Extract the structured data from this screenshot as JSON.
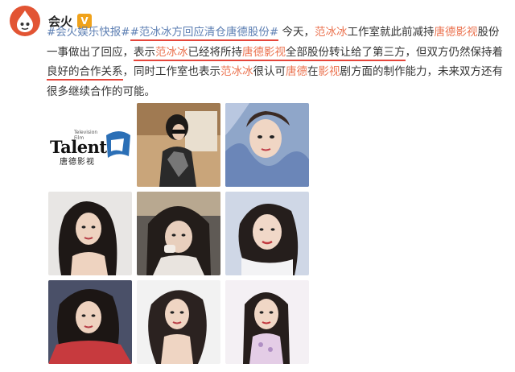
{
  "user": {
    "name": "会火",
    "verified_badge": "V",
    "avatar_icon": "flame-drop-icon"
  },
  "post": {
    "hashtag1": "#会火娱乐快报#",
    "hashtag2": "#范冰冰方回应清仓唐德股份#",
    "t1": " 今天，",
    "k1": "范冰冰",
    "t2": "工作室就此前减持",
    "k2": "唐德影视",
    "t3": "股份一事做出了回应，",
    "t4": "表示",
    "k3": "范冰冰",
    "t5": "已经将所持",
    "k4": "唐德影视",
    "t6": "全部股份转让给了第三方",
    "t7": "，但双方仍然保持着",
    "t8": "良好的合作关系",
    "t9": "，同时工作室也表示",
    "k5": "范冰冰",
    "t10": "很认可",
    "k6": "唐德",
    "t11": "在",
    "k7": "影视",
    "t12": "剧方面的制作能力，未来双方还有很多继续合作的可能。"
  },
  "logo": {
    "brand": "Talent",
    "cn": "唐德影视",
    "tv_line1": "Television",
    "tv_line2": "Film"
  },
  "images": [
    "logo-image",
    "photo-2",
    "photo-3",
    "photo-4",
    "photo-5",
    "photo-6",
    "photo-7",
    "photo-8",
    "photo-9"
  ],
  "colors": {
    "keyword": "#eb7350",
    "underline": "#e5453a",
    "badge": "#f0a21a",
    "avatar": "#e25433"
  }
}
